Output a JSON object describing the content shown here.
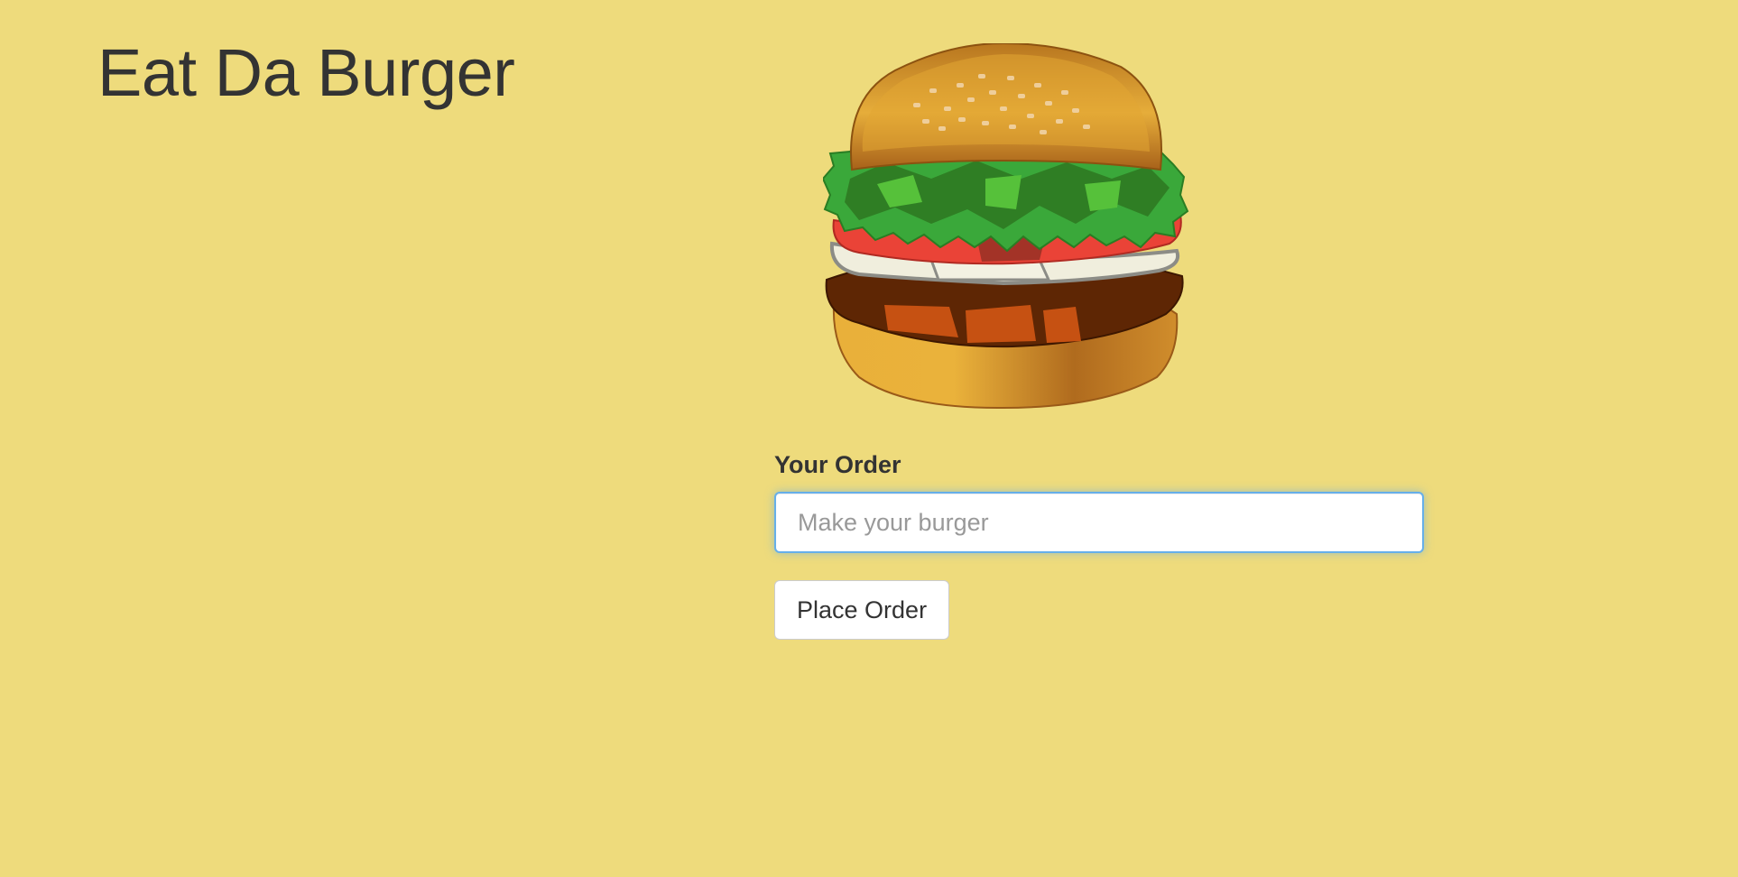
{
  "header": {
    "title": "Eat Da Burger"
  },
  "hero": {
    "image_icon": "burger-illustration"
  },
  "order_form": {
    "label": "Your Order",
    "input_value": "",
    "input_placeholder": "Make your burger",
    "submit_label": "Place Order"
  },
  "colors": {
    "background": "#eedb7c",
    "text": "#333333",
    "input_focus_border": "#66afe9"
  }
}
